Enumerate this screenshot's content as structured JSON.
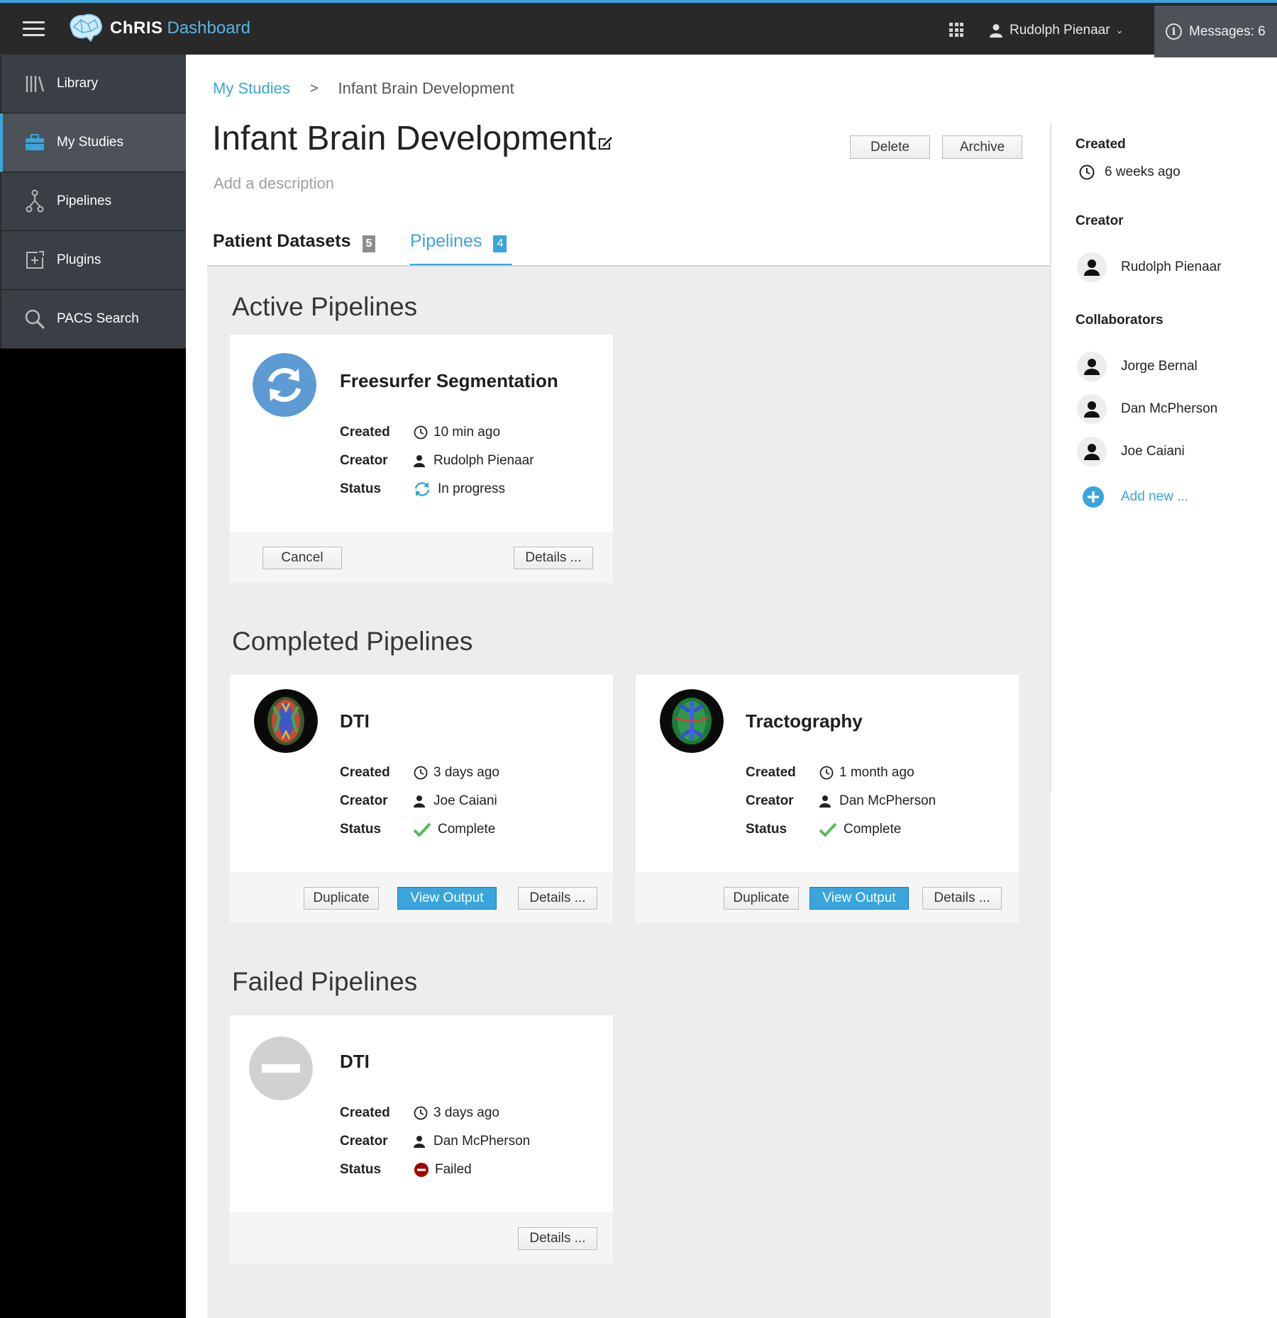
{
  "app": {
    "brand": "ChRIS",
    "brand_suffix": "Dashboard"
  },
  "topbar": {
    "user_name": "Rudolph Pienaar",
    "messages_label": "Messages: 6"
  },
  "sidebar": {
    "items": [
      {
        "label": "Library",
        "icon": "library-icon"
      },
      {
        "label": "My Studies",
        "icon": "briefcase-icon",
        "active": true
      },
      {
        "label": "Pipelines",
        "icon": "pipeline-icon"
      },
      {
        "label": "Plugins",
        "icon": "plugin-icon"
      },
      {
        "label": "PACS Search",
        "icon": "search-icon"
      }
    ]
  },
  "breadcrumb": {
    "parent": "My Studies",
    "separator": ">",
    "current": "Infant Brain Development"
  },
  "page": {
    "title": "Infant Brain Development",
    "description_placeholder": "Add a description",
    "delete_label": "Delete",
    "archive_label": "Archive"
  },
  "tabs": [
    {
      "label": "Patient Datasets",
      "count": "5"
    },
    {
      "label": "Pipelines",
      "count": "4",
      "active": true
    }
  ],
  "sections": {
    "active": "Active Pipelines",
    "completed": "Completed Pipelines",
    "failed": "Failed Pipelines"
  },
  "field_labels": {
    "created": "Created",
    "creator": "Creator",
    "status": "Status"
  },
  "buttons": {
    "cancel": "Cancel",
    "details": "Details ...",
    "duplicate": "Duplicate",
    "view_output": "View Output"
  },
  "pipelines": {
    "active": [
      {
        "name": "Freesurfer Segmentation",
        "created": "10 min ago",
        "creator": "Rudolph Pienaar",
        "status": "In progress"
      }
    ],
    "completed": [
      {
        "name": "DTI",
        "created": "3 days ago",
        "creator": "Joe Caiani",
        "status": "Complete"
      },
      {
        "name": "Tractography",
        "created": "1 month ago",
        "creator": "Dan McPherson",
        "status": "Complete"
      }
    ],
    "failed": [
      {
        "name": "DTI",
        "created": "3 days ago",
        "creator": "Dan McPherson",
        "status": "Failed"
      }
    ]
  },
  "details_panel": {
    "created_label": "Created",
    "created_value": "6 weeks ago",
    "creator_label": "Creator",
    "creator_name": "Rudolph Pienaar",
    "collaborators_label": "Collaborators",
    "collaborators": [
      "Jorge Bernal",
      "Dan McPherson",
      "Joe Caiani"
    ],
    "add_new_label": "Add new ..."
  },
  "colors": {
    "accent": "#39a5dc",
    "topbar": "#292929",
    "sidebar": "#393f44",
    "success": "#5cb85c",
    "danger": "#a30000"
  }
}
